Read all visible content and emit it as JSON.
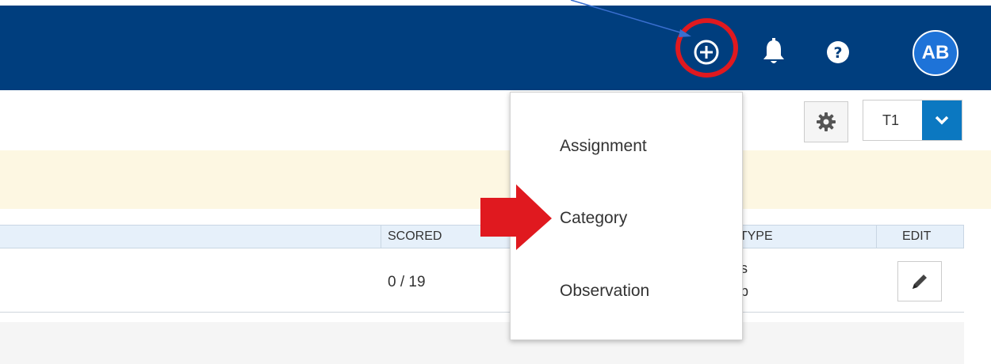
{
  "header": {
    "avatar_initials": "AB",
    "icons": {
      "add": "plus-circle-icon",
      "notifications": "bell-icon",
      "help": "question-circle-icon"
    },
    "background_color": "#003e7e"
  },
  "toolbar": {
    "settings_icon": "gear-icon",
    "term_selected": "T1",
    "term_caret_icon": "chevron-down-icon"
  },
  "table": {
    "columns": {
      "scored": "SCORED",
      "type": "E TYPE",
      "edit": "EDIT"
    },
    "rows": [
      {
        "scored": "0 / 19",
        "type_line1": "s",
        "type_line2": "p",
        "edit_icon": "pencil-icon"
      }
    ]
  },
  "add_menu": {
    "items": [
      {
        "label": "Assignment"
      },
      {
        "label": "Category"
      },
      {
        "label": "Observation"
      }
    ]
  },
  "annotations": {
    "highlight_color": "#e0191f",
    "pointer_line_color": "#3a6fd0"
  }
}
